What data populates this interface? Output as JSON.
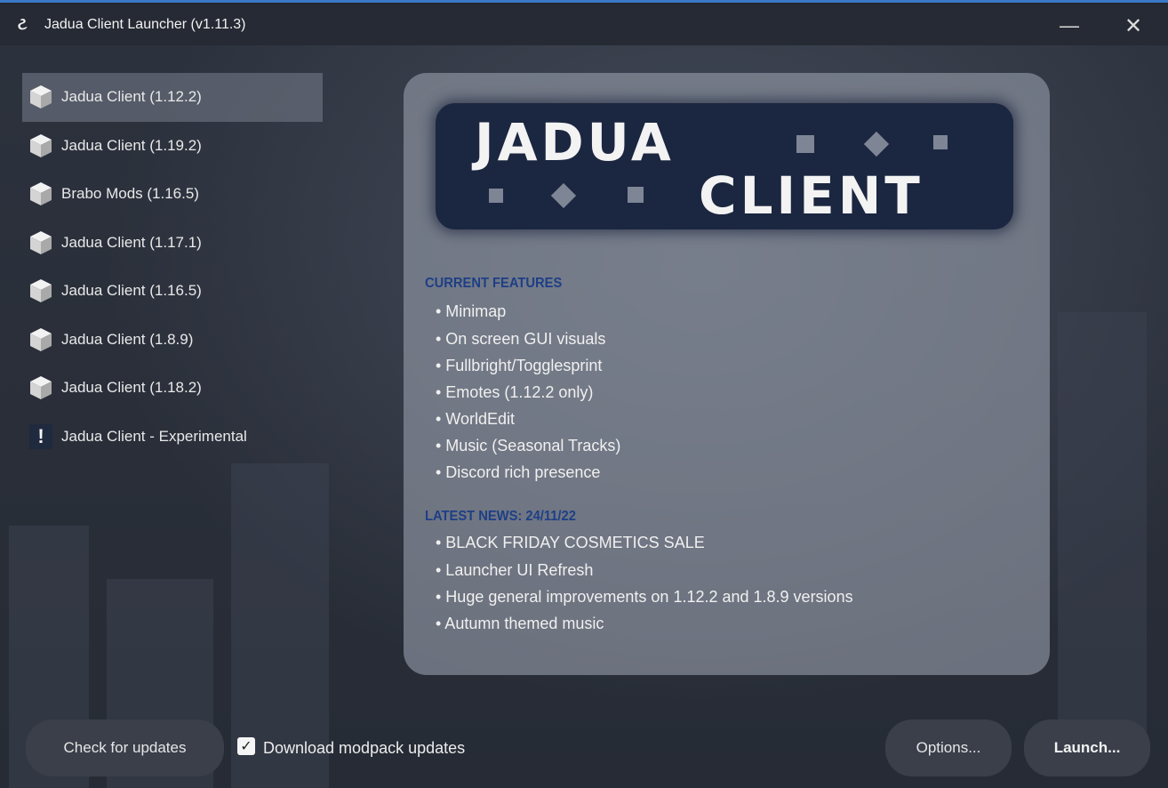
{
  "window": {
    "title": "Jadua Client Launcher (v1.11.3)",
    "minimize_symbol": "—",
    "close_symbol": "✕"
  },
  "sidebar": {
    "items": [
      {
        "label": "Jadua Client (1.12.2)",
        "icon": "cube-icon",
        "selected": true
      },
      {
        "label": "Jadua Client (1.19.2)",
        "icon": "cube-icon"
      },
      {
        "label": "Brabo Mods (1.16.5)",
        "icon": "cube-icon"
      },
      {
        "label": "Jadua Client (1.17.1)",
        "icon": "cube-icon"
      },
      {
        "label": "Jadua Client (1.16.5)",
        "icon": "cube-icon"
      },
      {
        "label": "Jadua Client (1.8.9)",
        "icon": "cube-icon"
      },
      {
        "label": "Jadua Client (1.18.2)",
        "icon": "cube-icon"
      },
      {
        "label": "Jadua Client - Experimental",
        "icon": "exclamation-icon"
      }
    ]
  },
  "info": {
    "logo_line1": "JADUA",
    "logo_line2": "CLIENT",
    "features_heading": "CURRENT FEATURES",
    "features": [
      "• Minimap",
      "• On screen GUI visuals",
      "• Fullbright/Togglesprint",
      "• Emotes (1.12.2 only)",
      "• WorldEdit",
      "• Music (Seasonal Tracks)",
      "• Discord rich presence"
    ],
    "news_heading": "LATEST NEWS: 24/11/22",
    "news": [
      "• BLACK FRIDAY COSMETICS SALE",
      "• Launcher UI Refresh",
      "• Huge general improvements on 1.12.2 and 1.8.9 versions",
      "• Autumn themed music"
    ]
  },
  "footer": {
    "check_updates_label": "Check for updates",
    "download_modpack_label": "Download modpack updates",
    "download_modpack_checked": true,
    "checkmark": "✓",
    "options_label": "Options...",
    "launch_label": "Launch..."
  },
  "colors": {
    "heading_blue": "#1e3f86",
    "logo_navy": "#1b2640",
    "accent_border": "#3a78c8"
  }
}
